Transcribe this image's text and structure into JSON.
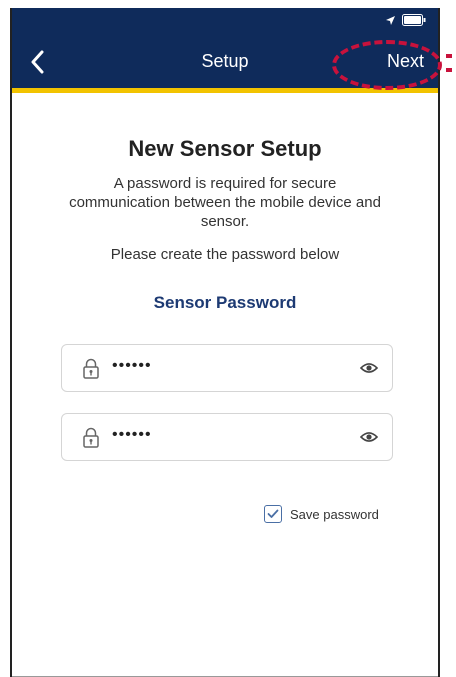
{
  "nav": {
    "title": "Setup",
    "next_label": "Next"
  },
  "main": {
    "title": "New Sensor Setup",
    "description": "A password is required for secure communication between the mobile device and sensor.",
    "instruction": "Please create the password below",
    "section_heading": "Sensor Password"
  },
  "fields": [
    {
      "value_masked": "••••••"
    },
    {
      "value_masked": "••••••"
    }
  ],
  "save_password": {
    "label": "Save password",
    "checked": true
  },
  "colors": {
    "nav_background": "#0f2b5b",
    "nav_accent": "#f2c300",
    "heading_blue": "#1d3a73",
    "highlight_red": "#c8123c"
  },
  "icons": [
    "back-chevron-icon",
    "location-arrow-icon",
    "battery-icon",
    "lock-icon",
    "eye-icon",
    "checkmark-icon"
  ]
}
